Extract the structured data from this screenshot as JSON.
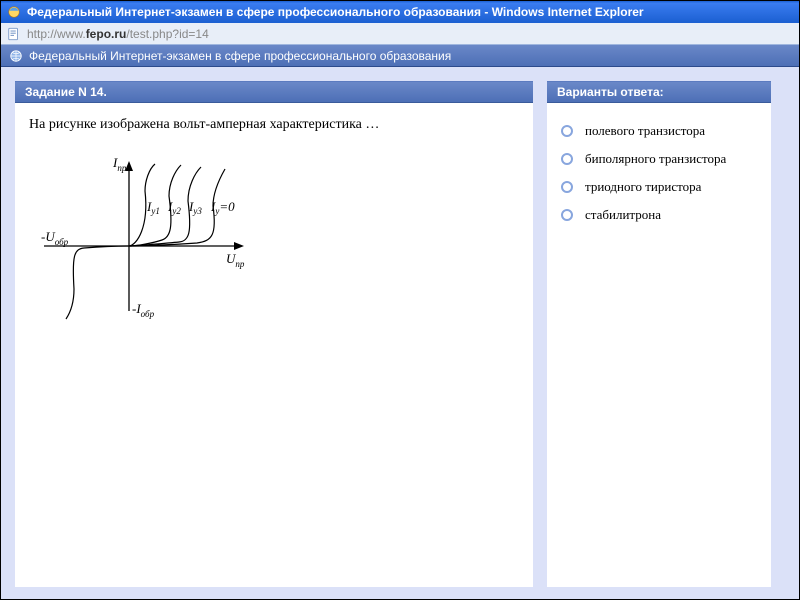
{
  "window": {
    "title": "Федеральный Интернет-экзамен в сфере профессионального образования - Windows Internet Explorer",
    "url_prefix": "http://www.",
    "url_domain": "fepo.ru",
    "url_path": "/test.php?id=14"
  },
  "ribbon": {
    "text": "Федеральный Интернет-экзамен в сфере профессионального образования"
  },
  "task": {
    "header": "Задание N 14.",
    "question": "На рисунке изображена вольт-амперная характеристика …",
    "diagram_labels": {
      "i_forward": "I",
      "i_forward_sub": "пр",
      "u_forward": "U",
      "u_forward_sub": "пр",
      "u_reverse": "-U",
      "u_reverse_sub": "обр",
      "i_reverse": "-I",
      "i_reverse_sub": "обр",
      "iy1": "I",
      "iy1_sub": "у1",
      "iy2": "I",
      "iy2_sub": "у2",
      "iy3": "I",
      "iy3_sub": "у3",
      "iy0": "I",
      "iy0_sub": "у",
      "iy0_eq": "=0"
    }
  },
  "answers": {
    "header": "Варианты ответа:",
    "options": [
      "полевого транзистора",
      "биполярного транзистора",
      "триодного тиристора",
      "стабилитрона"
    ]
  }
}
